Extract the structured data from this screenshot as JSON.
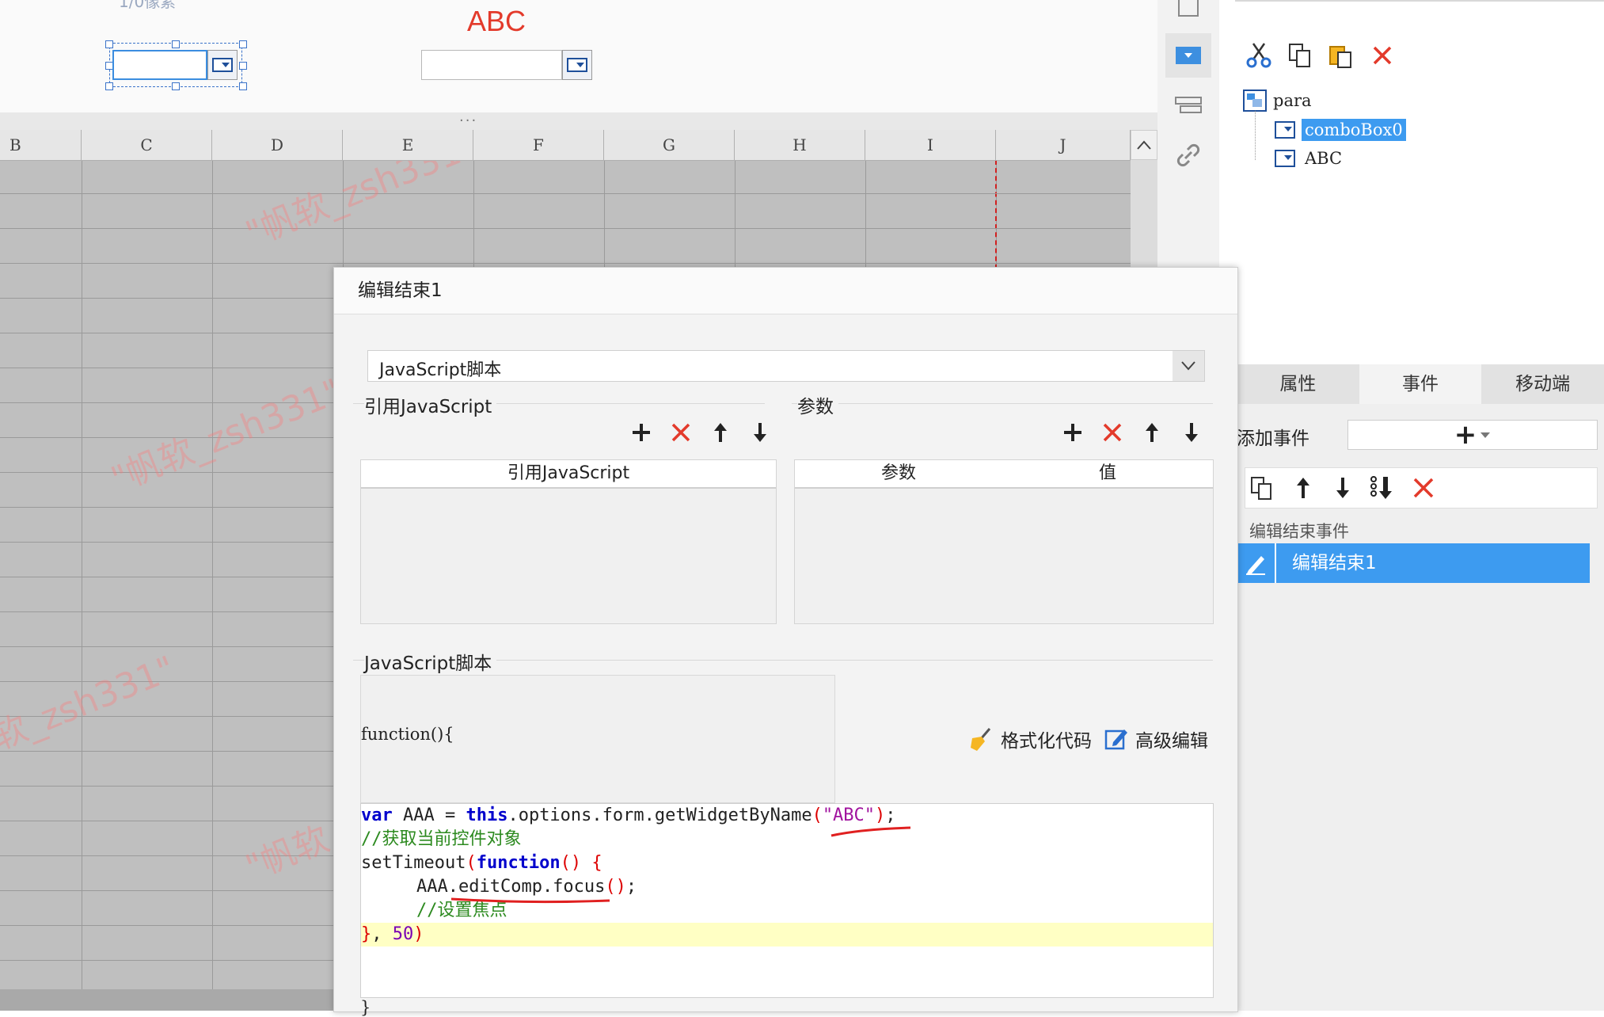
{
  "design": {
    "top_note": "1/0像素",
    "abc_label": "ABC",
    "splitter": "···"
  },
  "sheet": {
    "columns": [
      "B",
      "C",
      "D",
      "E",
      "F",
      "G",
      "H",
      "I",
      "J"
    ],
    "watermark": "\"帆软_zsh331\""
  },
  "toolbar_right": {
    "icons": [
      "cut-icon",
      "copy-icon",
      "paste-icon",
      "delete-icon"
    ]
  },
  "tree": {
    "root": "para",
    "children": [
      "comboBox0",
      "ABC"
    ],
    "selected": "comboBox0"
  },
  "tabs": [
    {
      "label": "属性"
    },
    {
      "label": "事件"
    },
    {
      "label": "移动端"
    }
  ],
  "events": {
    "add_label": "添加事件",
    "add_button": "+",
    "group_label": "编辑结束事件",
    "items": [
      "编辑结束1"
    ]
  },
  "dialog": {
    "title": "编辑结束1",
    "type_select": "JavaScript脚本",
    "ref_section": "引用JavaScript",
    "ref_column": "引用JavaScript",
    "param_section": "参数",
    "param_columns": [
      "参数",
      "值"
    ],
    "script_section": "JavaScript脚本",
    "function_header": "function(){",
    "format_button": "格式化代码",
    "advanced_button": "高级编辑",
    "code_lines": [
      "var AAA = this.options.form.getWidgetByName(\"ABC\");",
      "//获取当前控件对象",
      "setTimeout(function() {",
      "    AAA.editComp.focus();",
      "    //设置焦点",
      "}, 50)"
    ],
    "closing_brace": "}"
  },
  "colors": {
    "selected_blue": "#3d9bf0",
    "delete_red": "#e33a2b",
    "highlight_line": "#ffffc4"
  }
}
